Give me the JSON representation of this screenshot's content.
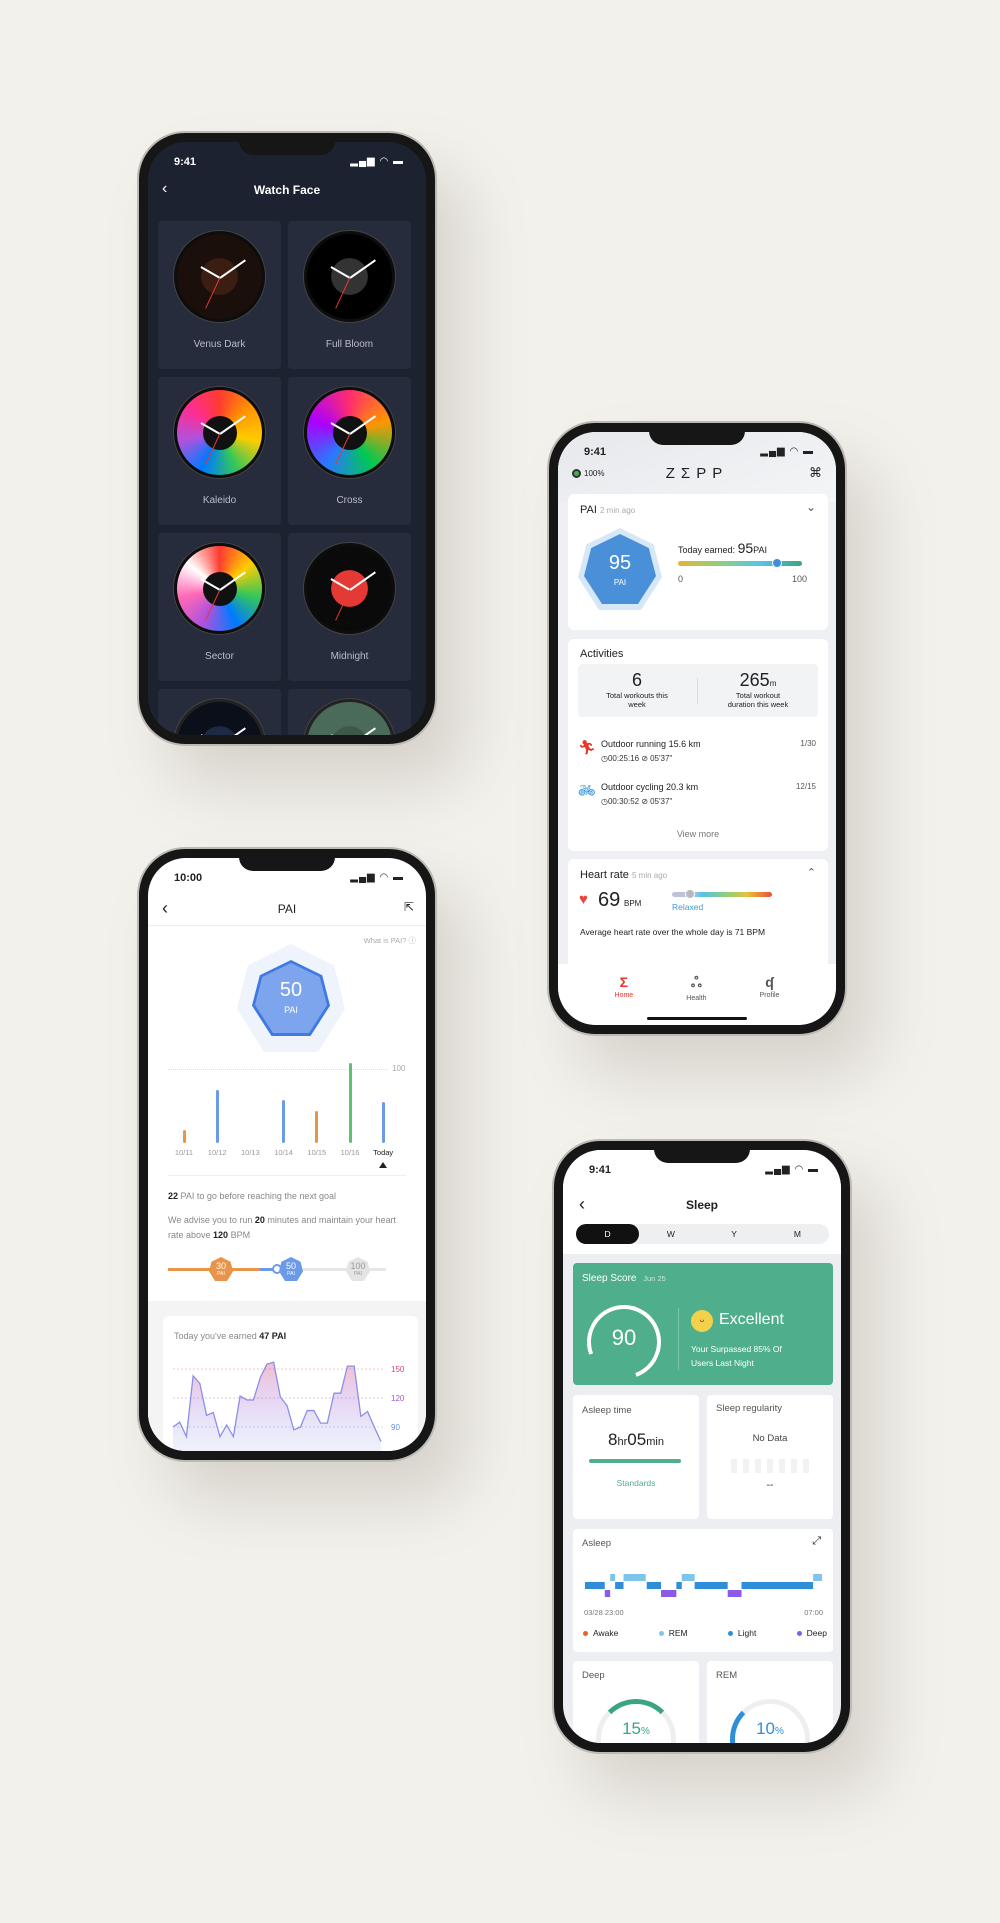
{
  "watch_face": {
    "status_time": "9:41",
    "title": "Watch Face",
    "faces": [
      {
        "name": "Venus Dark",
        "colors": [
          "#1a0f0a",
          "#e07a2e",
          "#3b1d12"
        ]
      },
      {
        "name": "Full Bloom",
        "colors": [
          "#000000",
          "#ffffff",
          "#333333"
        ]
      },
      {
        "name": "Kaleido",
        "colors": [
          "#ff3b30",
          "#ff9500",
          "#ffcc00",
          "#34c759",
          "#007aff",
          "#af52de",
          "#ff2d92"
        ]
      },
      {
        "name": "Cross",
        "colors": [
          "#ff2d6e",
          "#ff9500",
          "#00c853",
          "#2979ff",
          "#aa00ff"
        ]
      },
      {
        "name": "Sector",
        "colors": [
          "#ff3b30",
          "#ffcc00",
          "#34c759",
          "#007aff",
          "#af52de",
          "#ff69b4",
          "#ffffff"
        ]
      },
      {
        "name": "Midnight",
        "colors": [
          "#0a0a0a",
          "#ffffff",
          "#e53935"
        ]
      },
      {
        "name": "",
        "colors": [
          "#0a0f1a",
          "#3ec6e0",
          "#1c2a44"
        ]
      },
      {
        "name": "",
        "colors": [
          "#4a6a5a",
          "#ffffff",
          "#3c5848"
        ]
      }
    ]
  },
  "zepp": {
    "status_time": "9:41",
    "battery": "100%",
    "logo": "ZΣPP",
    "pai": {
      "title": "PAI",
      "updated": "2 min ago",
      "value": "95",
      "unit": "PAI",
      "today_label": "Today earned:",
      "today_value": "95",
      "today_unit": "PAI",
      "scale_min": "0",
      "scale_max": "100",
      "level_pct": 80
    },
    "activities": {
      "title": "Activities",
      "workouts": "6",
      "workouts_label": "Total workouts this week",
      "duration": "265",
      "duration_unit": "m",
      "duration_label": "Total workout duration this week",
      "items": [
        {
          "name": "Outdoor running",
          "distance": "15.6 km",
          "date": "1/30",
          "time": "00:25:16",
          "pace": "05'37''",
          "icon": "running-icon",
          "color": "#e8352b"
        },
        {
          "name": "Outdoor cycling",
          "distance": "20.3 km",
          "date": "12/15",
          "time": "00:30:52",
          "pace": "05'37''",
          "icon": "cycling-icon",
          "color": "#2e8fd8"
        }
      ],
      "view_more": "View more"
    },
    "heart": {
      "title": "Heart rate",
      "updated": "5 min ago",
      "value": "69",
      "unit": "BPM",
      "zone": "Relaxed",
      "level_pct": 18,
      "average": "Average heart rate over the whole day is 71 BPM"
    },
    "tabs": [
      {
        "label": "Home",
        "icon": "Σ",
        "active": true
      },
      {
        "label": "Health",
        "icon": "ஃ",
        "active": false
      },
      {
        "label": "Profile",
        "icon": "ʠ",
        "active": false
      }
    ],
    "colors": {
      "accent": "#e8352b",
      "pai": "#4a90d9"
    }
  },
  "pai": {
    "status_time": "10:00",
    "title": "PAI",
    "what_is": "What is PAI?",
    "value": "50",
    "unit": "PAI",
    "chart": {
      "max_label": "100",
      "max": 100,
      "days": [
        {
          "label": "10/11",
          "value": 18,
          "color": "#e8944a"
        },
        {
          "label": "10/12",
          "value": 72,
          "color": "#6b9ae8"
        },
        {
          "label": "10/13",
          "value": 0,
          "color": "#6b9ae8"
        },
        {
          "label": "10/14",
          "value": 58,
          "color": "#6b9ae8"
        },
        {
          "label": "10/15",
          "value": 43,
          "color": "#e8944a"
        },
        {
          "label": "10/16",
          "value": 108,
          "color": "#5cc26e"
        },
        {
          "label": "Today",
          "value": 56,
          "color": "#6b9ae8"
        }
      ]
    },
    "goal_num": "22",
    "goal_text": " PAI to go before reaching the next goal",
    "advise_1": "We advise you to run ",
    "advise_min": "20",
    "advise_2": " minutes and maintain your heart rate above ",
    "advise_bpm": "120",
    "advise_3": " BPM",
    "milestones": [
      {
        "value": "30",
        "unit": "PAI",
        "color": "#e8944a"
      },
      {
        "value": "50",
        "unit": "PAI",
        "color": "#6b9ae8"
      },
      {
        "value": "100",
        "unit": "PAI",
        "color": "#e4e4e4"
      }
    ],
    "earned_1": "Today you've earned ",
    "earned_value": "47 PAI",
    "hr_axis": [
      "150",
      "120",
      "90"
    ],
    "hr_series": [
      90,
      95,
      80,
      143,
      135,
      102,
      105,
      80,
      92,
      80,
      122,
      118,
      118,
      141,
      155,
      157,
      121,
      112,
      87,
      90,
      107,
      107,
      94,
      94,
      125,
      125,
      153,
      153,
      101,
      106,
      90,
      75
    ]
  },
  "sleep": {
    "status_time": "9:41",
    "title": "Sleep",
    "periods": [
      "D",
      "W",
      "Y",
      "M"
    ],
    "active_period": "D",
    "score": {
      "title": "Sleep Score",
      "date": "Jun 25",
      "value": "90",
      "rating": "Excellent",
      "text": "Your  Surpassed 85% Of Users Last Night",
      "color": "#4fae8c"
    },
    "asleep_time": {
      "title": "Asleep time",
      "hours": "8",
      "hr": "hr",
      "minutes": "05",
      "min": "min",
      "link": "Standards"
    },
    "regularity": {
      "title": "Sleep regularity",
      "status": "No Data",
      "value": "--"
    },
    "asleep": {
      "title": "Asleep",
      "start": "03/28 23:00",
      "end": "07:00",
      "legend": [
        {
          "label": "Awake",
          "color": "#e8622b"
        },
        {
          "label": "REM",
          "color": "#7fc4ea"
        },
        {
          "label": "Light",
          "color": "#2e8fd8"
        },
        {
          "label": "Deep",
          "color": "#8a5ae8"
        }
      ],
      "segments": [
        [
          "Light",
          "23:00",
          "23:40"
        ],
        [
          "Deep",
          "23:40",
          "23:51"
        ],
        [
          "REM",
          "23:51",
          "00:01"
        ],
        [
          "Light",
          "00:01",
          "00:18"
        ],
        [
          "REM",
          "00:18",
          "01:03"
        ],
        [
          "Light",
          "01:05",
          "01:34"
        ],
        [
          "Deep",
          "01:34",
          "02:05"
        ],
        [
          "Light",
          "02:05",
          "02:16"
        ],
        [
          "REM",
          "02:16",
          "02:42"
        ],
        [
          "Light",
          "02:42",
          "03:49"
        ],
        [
          "Deep",
          "03:49",
          "04:17"
        ],
        [
          "Light",
          "04:17",
          "06:42"
        ],
        [
          "REM",
          "06:42",
          "07:00"
        ]
      ]
    },
    "deep": {
      "title": "Deep",
      "value": "15",
      "unit": "%",
      "color": "#3aa57f"
    },
    "rem": {
      "title": "REM",
      "value": "10",
      "unit": "%",
      "color": "#2e8fd8"
    }
  }
}
